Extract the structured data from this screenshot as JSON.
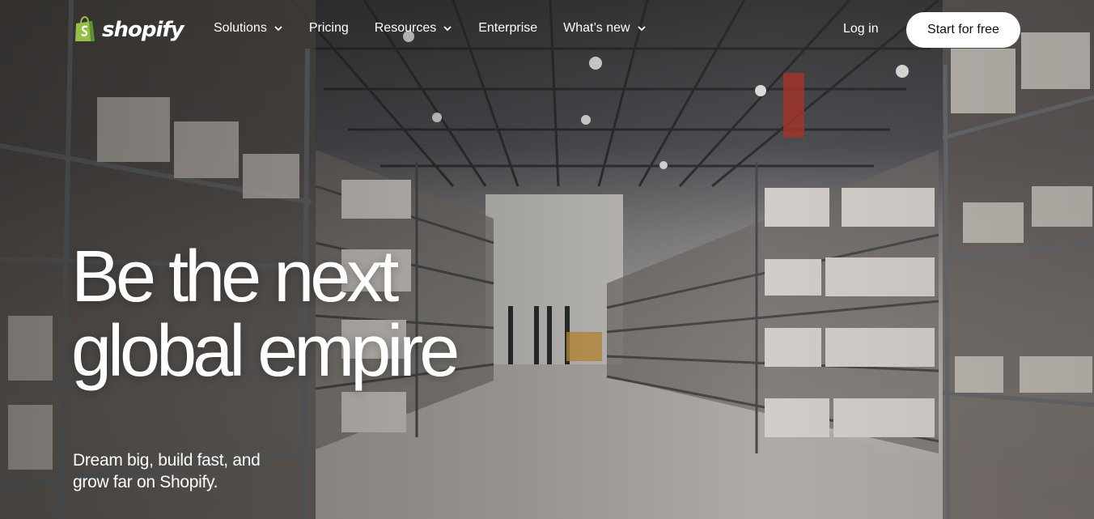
{
  "brand": {
    "name": "shopify",
    "accent": "#95bf47"
  },
  "nav": {
    "items": [
      {
        "label": "Solutions",
        "has_dropdown": true
      },
      {
        "label": "Pricing",
        "has_dropdown": false
      },
      {
        "label": "Resources",
        "has_dropdown": true
      },
      {
        "label": "Enterprise",
        "has_dropdown": false
      },
      {
        "label": "What’s new",
        "has_dropdown": true
      }
    ],
    "login_label": "Log in",
    "cta_label": "Start for free"
  },
  "hero": {
    "headline_line1": "Be the next",
    "headline_line2": "global empire",
    "subhead": "Dream big, build fast, and grow far on Shopify."
  }
}
